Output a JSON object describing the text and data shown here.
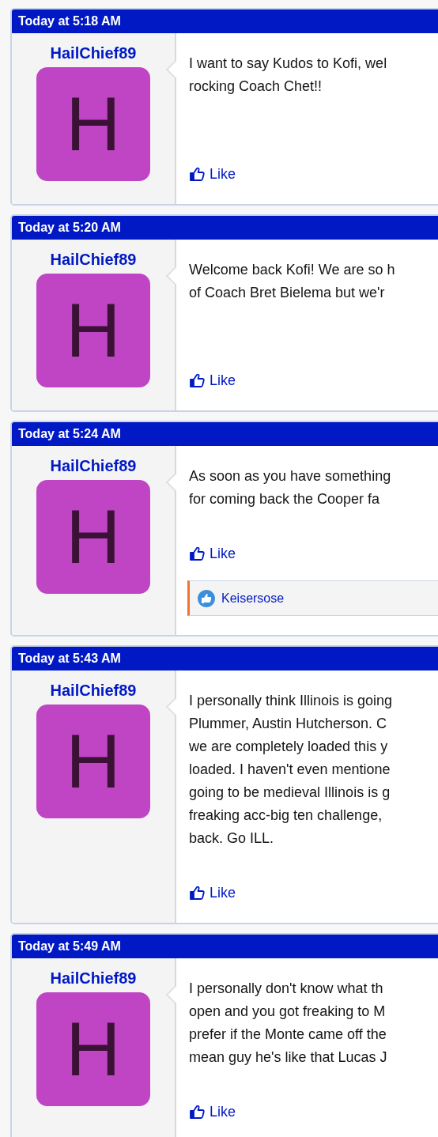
{
  "posts": [
    {
      "date": "Today at 5:18 AM",
      "username": "HailChief89",
      "avatar_letter": "H",
      "lines": [
        "I want to say Kudos to Kofi, wel",
        "rocking Coach Chet!!"
      ],
      "like": "Like"
    },
    {
      "date": "Today at 5:20 AM",
      "username": "HailChief89",
      "avatar_letter": "H",
      "lines": [
        "Welcome back Kofi! We are so h",
        "of Coach Bret Bielema but we'r"
      ],
      "like": "Like"
    },
    {
      "date": "Today at 5:24 AM",
      "username": "HailChief89",
      "avatar_letter": "H",
      "lines": [
        "As soon as you have something",
        "for coming back the Cooper fa"
      ],
      "like": "Like",
      "likers": [
        "Keisersose"
      ]
    },
    {
      "date": "Today at 5:43 AM",
      "username": "HailChief89",
      "avatar_letter": "H",
      "lines": [
        "I personally think Illinois is going",
        "Plummer, Austin Hutcherson. C",
        "we are completely loaded this y",
        "loaded. I haven't even mentione",
        "going to be medieval Illinois is g",
        "freaking acc-big ten challenge,",
        "back. Go ILL."
      ],
      "like": "Like"
    },
    {
      "date": "Today at 5:49 AM",
      "username": "HailChief89",
      "avatar_letter": "H",
      "lines": [
        "I personally don't know what th",
        "open and you got freaking to M",
        "prefer if the Monte came off the",
        "mean guy he's like that Lucas J"
      ],
      "like": "Like"
    }
  ]
}
